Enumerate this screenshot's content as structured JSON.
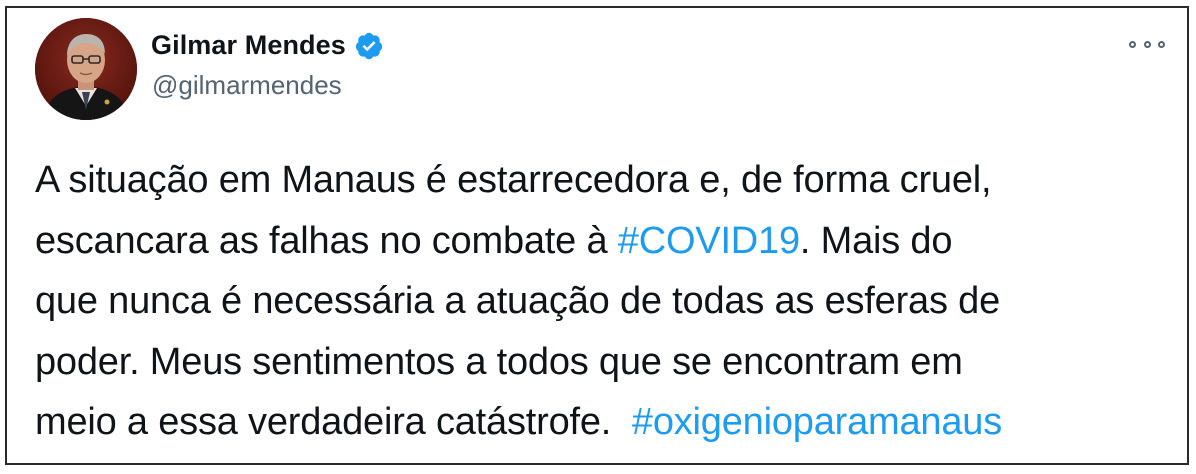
{
  "author": {
    "display_name": "Gilmar Mendes",
    "handle": "@gilmarmendes",
    "verified": true
  },
  "menu": {
    "icon": "more-horizontal-icon"
  },
  "tweet": {
    "line1": "A situação em Manaus é estarrecedora e, de forma cruel,",
    "line2_pre": "escancara as falhas no combate à ",
    "hashtag1": "#COVID19",
    "line2_post": ". Mais do",
    "line3": "que nunca é necessária a atuação de todas as esferas de",
    "line4": "poder. Meus sentimentos a todos que se encontram em",
    "line5_pre": "meio a essa verdadeira catástrofe.  ",
    "hashtag2": "#oxigenioparamanaus"
  },
  "colors": {
    "hashtag": "#1d9bf0",
    "verified_badge": "#1d9bf0",
    "text": "#0f1419",
    "handle": "#536471"
  }
}
